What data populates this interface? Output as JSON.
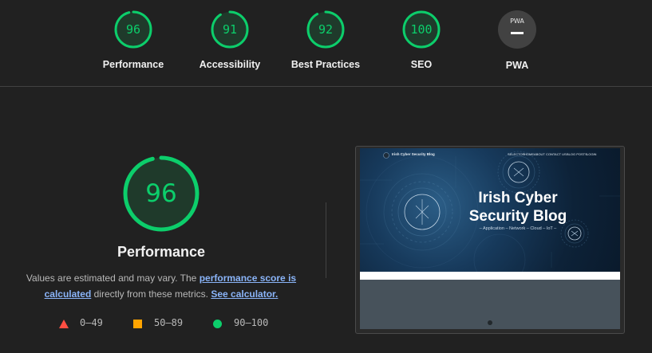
{
  "categories": [
    {
      "label": "Performance",
      "score": "96",
      "value": 96
    },
    {
      "label": "Accessibility",
      "score": "91",
      "value": 91
    },
    {
      "label": "Best Practices",
      "score": "92",
      "value": 92
    },
    {
      "label": "SEO",
      "score": "100",
      "value": 100
    }
  ],
  "pwa": {
    "label": "PWA",
    "badge": "PWA"
  },
  "main": {
    "score": "96",
    "value": 96,
    "title": "Performance",
    "desc_prefix": "Values are estimated and may vary. The ",
    "link_score": "performance score is calculated",
    "desc_middle": " directly from these metrics. ",
    "link_calc": "See calculator."
  },
  "legend": {
    "fail": "0–49",
    "average": "50–89",
    "pass": "90–100"
  },
  "screenshot": {
    "site_name": "Irish Cyber Security Blog",
    "nav": [
      "SELECTOR",
      "HOME",
      "ABOUT",
      "CONTACT US",
      "BLOG POSTS",
      "LOGIN"
    ],
    "hero_line1": "Irish Cyber",
    "hero_line2": "Security Blog",
    "hero_sub": "– Application – Network – Cloud – IoT –"
  },
  "colors": {
    "pass": "#0cce6b",
    "average": "#ffa400",
    "fail": "#ff4e42",
    "link": "#8ab4f8",
    "background": "#212121"
  }
}
